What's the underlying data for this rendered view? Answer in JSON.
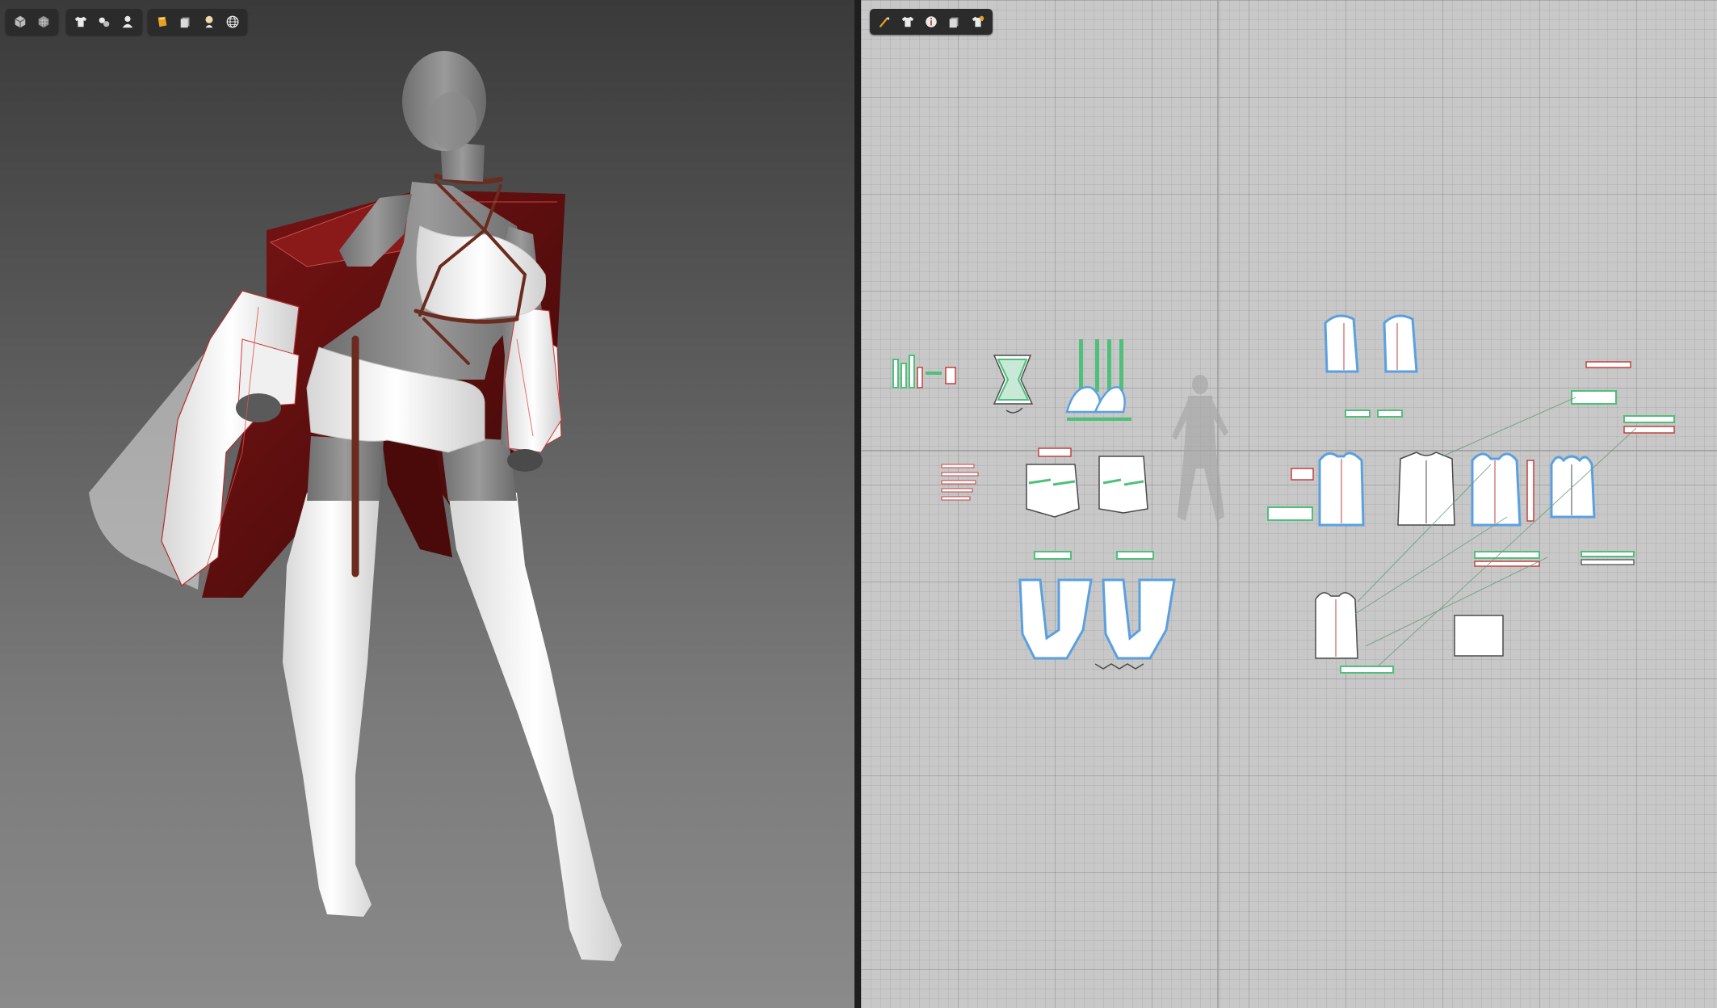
{
  "window": {
    "panes": [
      "3d-garment-window",
      "2d-pattern-window"
    ]
  },
  "toolbar3d": {
    "groups": [
      [
        {
          "icon": "cube-display-icon"
        },
        {
          "icon": "texture-display-icon"
        }
      ],
      [
        {
          "icon": "garment-shirt-icon"
        },
        {
          "icon": "pins-icon"
        },
        {
          "icon": "avatar-icon"
        }
      ],
      [
        {
          "icon": "fabric-swatch-icon"
        },
        {
          "icon": "material-layers-icon"
        },
        {
          "icon": "avatar-head-icon"
        },
        {
          "icon": "globe-icon"
        }
      ]
    ]
  },
  "toolbar2d": {
    "items": [
      {
        "icon": "pattern-brush-icon"
      },
      {
        "icon": "pattern-shirt-icon"
      },
      {
        "icon": "info-circle-icon"
      },
      {
        "icon": "fabric-layers-icon"
      },
      {
        "icon": "shirt-arrangement-icon"
      }
    ]
  },
  "colors": {
    "panel_bg": "#c8c8c8",
    "pattern_fill": "#ffffff",
    "pattern_outline": "#5aa0e0",
    "seam_green": "#4fbf7a",
    "coat_red": "#5c0f0f",
    "strap_brown": "#6b2b1f",
    "avatar_gray": "#8c8c8c"
  }
}
